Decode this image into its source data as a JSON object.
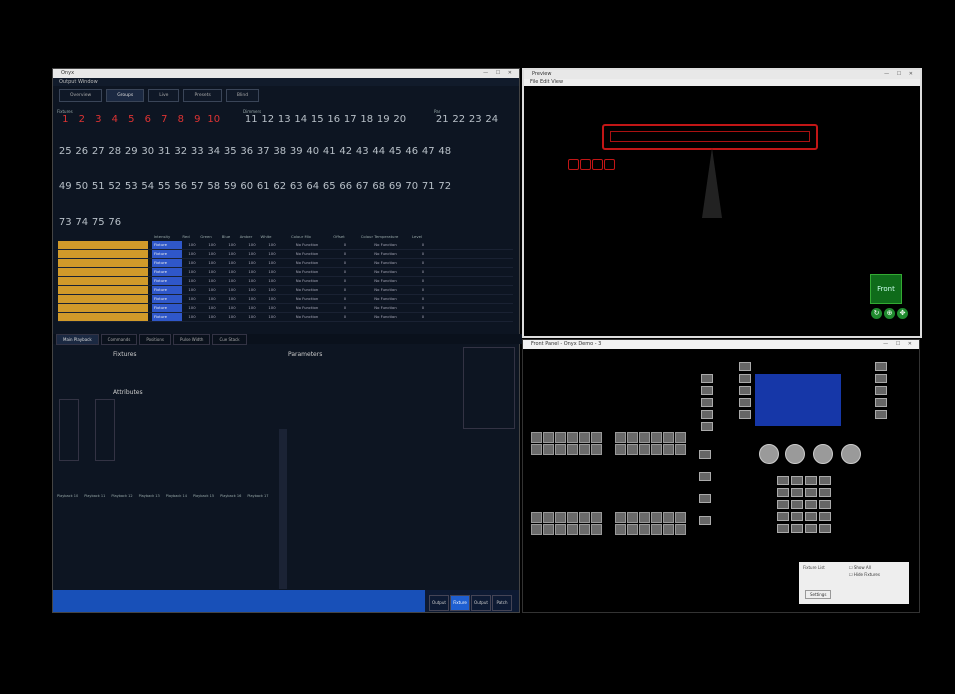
{
  "left_window": {
    "title": "Onyx",
    "menu": "Output Window",
    "tabs": [
      "Overview",
      "Groups",
      "Live",
      "Presets",
      "Blind"
    ],
    "channel_groups": [
      {
        "label": "Fixtures",
        "channels": [
          "1",
          "2",
          "3",
          "4",
          "5",
          "6",
          "7",
          "8",
          "9",
          "10"
        ]
      },
      {
        "label": "Dimmers",
        "channels": [
          "11",
          "12",
          "13",
          "14",
          "15",
          "16",
          "17",
          "18",
          "19",
          "20"
        ]
      },
      {
        "label": "Par",
        "channels": [
          "21",
          "22",
          "23",
          "24"
        ]
      }
    ],
    "row2": [
      "25",
      "26",
      "27",
      "28",
      "29",
      "30",
      "31",
      "32",
      "33",
      "34",
      "35",
      "36",
      "37",
      "38",
      "39",
      "40",
      "41",
      "42",
      "43",
      "44",
      "45",
      "46",
      "47",
      "48"
    ],
    "row3": [
      "49",
      "50",
      "51",
      "52",
      "53",
      "54",
      "55",
      "56",
      "57",
      "58",
      "59",
      "60",
      "61",
      "62",
      "63",
      "64",
      "65",
      "66",
      "67",
      "68",
      "69",
      "70",
      "71",
      "72"
    ],
    "row4": [
      "73",
      "74",
      "75",
      "76"
    ],
    "table_headers": [
      "Intensity",
      "Red",
      "Green",
      "Blue",
      "Amber",
      "White",
      "Colour Mix",
      "Offset",
      "Colour Temperature",
      "Level"
    ],
    "table_rows": [
      {
        "mode": "Fixture",
        "v": [
          "100",
          "100",
          "100",
          "100",
          "100"
        ],
        "fn": "No Function",
        "off": "0",
        "dc": "No Function",
        "lvl": "0"
      },
      {
        "mode": "Fixture",
        "v": [
          "100",
          "100",
          "100",
          "100",
          "100"
        ],
        "fn": "No Function",
        "off": "0",
        "dc": "No Function",
        "lvl": "0"
      },
      {
        "mode": "Fixture",
        "v": [
          "100",
          "100",
          "100",
          "100",
          "100"
        ],
        "fn": "No Function",
        "off": "0",
        "dc": "No Function",
        "lvl": "0"
      },
      {
        "mode": "Fixture",
        "v": [
          "100",
          "100",
          "100",
          "100",
          "100"
        ],
        "fn": "No Function",
        "off": "0",
        "dc": "No Function",
        "lvl": "0"
      },
      {
        "mode": "Fixture",
        "v": [
          "100",
          "100",
          "100",
          "100",
          "100"
        ],
        "fn": "No Function",
        "off": "0",
        "dc": "No Function",
        "lvl": "0"
      },
      {
        "mode": "Fixture",
        "v": [
          "100",
          "100",
          "100",
          "100",
          "100"
        ],
        "fn": "No Function",
        "off": "0",
        "dc": "No Function",
        "lvl": "0"
      },
      {
        "mode": "Fixture",
        "v": [
          "100",
          "100",
          "100",
          "100",
          "100"
        ],
        "fn": "No Function",
        "off": "0",
        "dc": "No Function",
        "lvl": "0"
      },
      {
        "mode": "Fixture",
        "v": [
          "100",
          "100",
          "100",
          "100",
          "100"
        ],
        "fn": "No Function",
        "off": "0",
        "dc": "No Function",
        "lvl": "0"
      },
      {
        "mode": "Fixture",
        "v": [
          "100",
          "100",
          "100",
          "100",
          "100"
        ],
        "fn": "No Function",
        "off": "0",
        "dc": "No Function",
        "lvl": "0"
      }
    ],
    "sub_tabs": [
      "Main Playback",
      "Commands",
      "Positions",
      "Pulse Width",
      "Cue Stack"
    ],
    "sections": {
      "fixtures": "Fixtures",
      "parameters": "Parameters",
      "attributes": "Attributes"
    },
    "playback_labels": [
      "Playback 10",
      "Playback 11",
      "Playback 12",
      "Playback 13",
      "Playback 14",
      "Playback 15",
      "Playback 16",
      "Playback 17"
    ],
    "bottom_buttons": [
      "Output",
      "Fixture",
      "Output",
      "Patch"
    ]
  },
  "right_top": {
    "title": "Preview",
    "menu": "File  Edit  View",
    "front_label": "Front"
  },
  "right_bottom": {
    "title": "Front Panel - Onyx Demo - 3",
    "panel_label": "Fixture List",
    "checkbox_a": "Show All",
    "checkbox_b": "Hide Fixtures",
    "panel_button": "Settings"
  }
}
